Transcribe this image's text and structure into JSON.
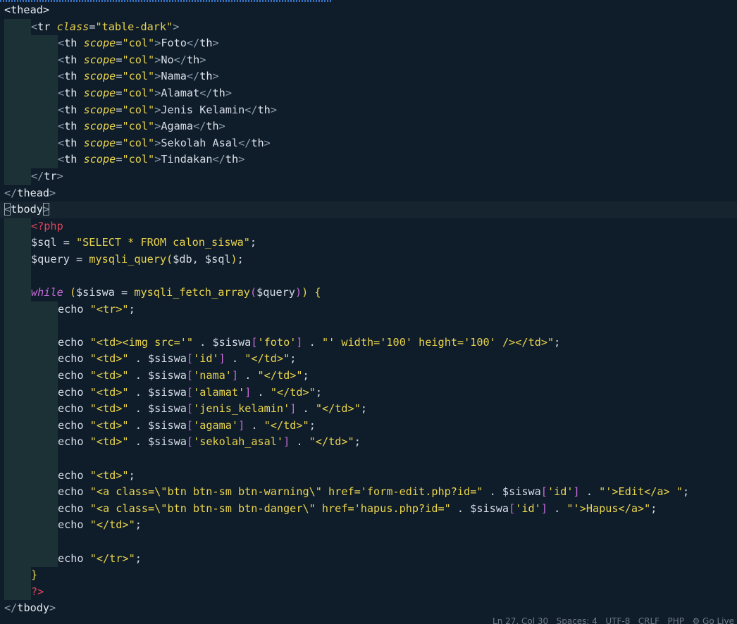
{
  "editor": {
    "language": "PHP",
    "lines": [
      {
        "indent": 0,
        "current": false,
        "tokens": [
          [
            "tag",
            "<thead>"
          ]
        ]
      },
      {
        "indent": 1,
        "current": false,
        "tokens": [
          [
            "punc",
            "<"
          ],
          [
            "tag",
            "tr "
          ],
          [
            "attr",
            "class"
          ],
          [
            "op",
            "="
          ],
          [
            "str",
            "\"table-dark\""
          ],
          [
            "punc",
            ">"
          ]
        ]
      },
      {
        "indent": 2,
        "current": false,
        "tokens": [
          [
            "punc",
            "<"
          ],
          [
            "tag",
            "th "
          ],
          [
            "attr",
            "scope"
          ],
          [
            "op",
            "="
          ],
          [
            "str",
            "\"col\""
          ],
          [
            "punc",
            ">"
          ],
          [
            "plain",
            "Foto"
          ],
          [
            "punc",
            "</"
          ],
          [
            "tag",
            "th"
          ],
          [
            "punc",
            ">"
          ]
        ]
      },
      {
        "indent": 2,
        "current": false,
        "tokens": [
          [
            "punc",
            "<"
          ],
          [
            "tag",
            "th "
          ],
          [
            "attr",
            "scope"
          ],
          [
            "op",
            "="
          ],
          [
            "str",
            "\"col\""
          ],
          [
            "punc",
            ">"
          ],
          [
            "plain",
            "No"
          ],
          [
            "punc",
            "</"
          ],
          [
            "tag",
            "th"
          ],
          [
            "punc",
            ">"
          ]
        ]
      },
      {
        "indent": 2,
        "current": false,
        "tokens": [
          [
            "punc",
            "<"
          ],
          [
            "tag",
            "th "
          ],
          [
            "attr",
            "scope"
          ],
          [
            "op",
            "="
          ],
          [
            "str",
            "\"col\""
          ],
          [
            "punc",
            ">"
          ],
          [
            "plain",
            "Nama"
          ],
          [
            "punc",
            "</"
          ],
          [
            "tag",
            "th"
          ],
          [
            "punc",
            ">"
          ]
        ]
      },
      {
        "indent": 2,
        "current": false,
        "tokens": [
          [
            "punc",
            "<"
          ],
          [
            "tag",
            "th "
          ],
          [
            "attr",
            "scope"
          ],
          [
            "op",
            "="
          ],
          [
            "str",
            "\"col\""
          ],
          [
            "punc",
            ">"
          ],
          [
            "plain",
            "Alamat"
          ],
          [
            "punc",
            "</"
          ],
          [
            "tag",
            "th"
          ],
          [
            "punc",
            ">"
          ]
        ]
      },
      {
        "indent": 2,
        "current": false,
        "tokens": [
          [
            "punc",
            "<"
          ],
          [
            "tag",
            "th "
          ],
          [
            "attr",
            "scope"
          ],
          [
            "op",
            "="
          ],
          [
            "str",
            "\"col\""
          ],
          [
            "punc",
            ">"
          ],
          [
            "plain",
            "Jenis Kelamin"
          ],
          [
            "punc",
            "</"
          ],
          [
            "tag",
            "th"
          ],
          [
            "punc",
            ">"
          ]
        ]
      },
      {
        "indent": 2,
        "current": false,
        "tokens": [
          [
            "punc",
            "<"
          ],
          [
            "tag",
            "th "
          ],
          [
            "attr",
            "scope"
          ],
          [
            "op",
            "="
          ],
          [
            "str",
            "\"col\""
          ],
          [
            "punc",
            ">"
          ],
          [
            "plain",
            "Agama"
          ],
          [
            "punc",
            "</"
          ],
          [
            "tag",
            "th"
          ],
          [
            "punc",
            ">"
          ]
        ]
      },
      {
        "indent": 2,
        "current": false,
        "tokens": [
          [
            "punc",
            "<"
          ],
          [
            "tag",
            "th "
          ],
          [
            "attr",
            "scope"
          ],
          [
            "op",
            "="
          ],
          [
            "str",
            "\"col\""
          ],
          [
            "punc",
            ">"
          ],
          [
            "plain",
            "Sekolah Asal"
          ],
          [
            "punc",
            "</"
          ],
          [
            "tag",
            "th"
          ],
          [
            "punc",
            ">"
          ]
        ]
      },
      {
        "indent": 2,
        "current": false,
        "tokens": [
          [
            "punc",
            "<"
          ],
          [
            "tag",
            "th "
          ],
          [
            "attr",
            "scope"
          ],
          [
            "op",
            "="
          ],
          [
            "str",
            "\"col\""
          ],
          [
            "punc",
            ">"
          ],
          [
            "plain",
            "Tindakan"
          ],
          [
            "punc",
            "</"
          ],
          [
            "tag",
            "th"
          ],
          [
            "punc",
            ">"
          ]
        ]
      },
      {
        "indent": 1,
        "current": false,
        "tokens": [
          [
            "punc",
            "</"
          ],
          [
            "tag",
            "tr"
          ],
          [
            "punc",
            ">"
          ]
        ]
      },
      {
        "indent": 0,
        "current": false,
        "tokens": [
          [
            "punc",
            "</"
          ],
          [
            "tag",
            "thead"
          ],
          [
            "punc",
            ">"
          ]
        ]
      },
      {
        "indent": 0,
        "current": true,
        "tokens": [
          [
            "box",
            "<"
          ],
          [
            "tag",
            "tbody"
          ],
          [
            "box",
            ">"
          ]
        ]
      },
      {
        "indent": 1,
        "current": false,
        "tokens": [
          [
            "php",
            "<?php"
          ]
        ]
      },
      {
        "indent": 1,
        "current": false,
        "tokens": [
          [
            "var",
            "$sql "
          ],
          [
            "op",
            "= "
          ],
          [
            "str",
            "\"SELECT * FROM calon_siswa\""
          ],
          [
            "op",
            ";"
          ]
        ]
      },
      {
        "indent": 1,
        "current": false,
        "tokens": [
          [
            "var",
            "$query "
          ],
          [
            "op",
            "= "
          ],
          [
            "func",
            "mysqli_query"
          ],
          [
            "brace",
            "("
          ],
          [
            "var",
            "$db, $sql"
          ],
          [
            "brace",
            ")"
          ],
          [
            "op",
            ";"
          ]
        ]
      },
      {
        "indent": 1,
        "current": false,
        "tokens": []
      },
      {
        "indent": 1,
        "current": false,
        "tokens": [
          [
            "kw",
            "while "
          ],
          [
            "brace",
            "("
          ],
          [
            "var",
            "$siswa "
          ],
          [
            "op",
            "= "
          ],
          [
            "func",
            "mysqli_fetch_array"
          ],
          [
            "paren2",
            "("
          ],
          [
            "var",
            "$query"
          ],
          [
            "paren2",
            ")"
          ],
          [
            "brace",
            ") {"
          ]
        ]
      },
      {
        "indent": 2,
        "current": false,
        "tokens": [
          [
            "plain",
            "echo "
          ],
          [
            "str",
            "\"<tr>\""
          ],
          [
            "op",
            ";"
          ]
        ]
      },
      {
        "indent": 2,
        "current": false,
        "tokens": []
      },
      {
        "indent": 2,
        "current": false,
        "tokens": [
          [
            "plain",
            "echo "
          ],
          [
            "str",
            "\"<td><img src='\""
          ],
          [
            "op",
            " . "
          ],
          [
            "var",
            "$siswa"
          ],
          [
            "paren2",
            "["
          ],
          [
            "str",
            "'foto'"
          ],
          [
            "paren2",
            "]"
          ],
          [
            "op",
            " . "
          ],
          [
            "str",
            "\"' width='100' height='100' /></td>\""
          ],
          [
            "op",
            ";"
          ]
        ]
      },
      {
        "indent": 2,
        "current": false,
        "tokens": [
          [
            "plain",
            "echo "
          ],
          [
            "str",
            "\"<td>\""
          ],
          [
            "op",
            " . "
          ],
          [
            "var",
            "$siswa"
          ],
          [
            "paren2",
            "["
          ],
          [
            "str",
            "'id'"
          ],
          [
            "paren2",
            "]"
          ],
          [
            "op",
            " . "
          ],
          [
            "str",
            "\"</td>\""
          ],
          [
            "op",
            ";"
          ]
        ]
      },
      {
        "indent": 2,
        "current": false,
        "tokens": [
          [
            "plain",
            "echo "
          ],
          [
            "str",
            "\"<td>\""
          ],
          [
            "op",
            " . "
          ],
          [
            "var",
            "$siswa"
          ],
          [
            "paren2",
            "["
          ],
          [
            "str",
            "'nama'"
          ],
          [
            "paren2",
            "]"
          ],
          [
            "op",
            " . "
          ],
          [
            "str",
            "\"</td>\""
          ],
          [
            "op",
            ";"
          ]
        ]
      },
      {
        "indent": 2,
        "current": false,
        "tokens": [
          [
            "plain",
            "echo "
          ],
          [
            "str",
            "\"<td>\""
          ],
          [
            "op",
            " . "
          ],
          [
            "var",
            "$siswa"
          ],
          [
            "paren2",
            "["
          ],
          [
            "str",
            "'alamat'"
          ],
          [
            "paren2",
            "]"
          ],
          [
            "op",
            " . "
          ],
          [
            "str",
            "\"</td>\""
          ],
          [
            "op",
            ";"
          ]
        ]
      },
      {
        "indent": 2,
        "current": false,
        "tokens": [
          [
            "plain",
            "echo "
          ],
          [
            "str",
            "\"<td>\""
          ],
          [
            "op",
            " . "
          ],
          [
            "var",
            "$siswa"
          ],
          [
            "paren2",
            "["
          ],
          [
            "str",
            "'jenis_kelamin'"
          ],
          [
            "paren2",
            "]"
          ],
          [
            "op",
            " . "
          ],
          [
            "str",
            "\"</td>\""
          ],
          [
            "op",
            ";"
          ]
        ]
      },
      {
        "indent": 2,
        "current": false,
        "tokens": [
          [
            "plain",
            "echo "
          ],
          [
            "str",
            "\"<td>\""
          ],
          [
            "op",
            " . "
          ],
          [
            "var",
            "$siswa"
          ],
          [
            "paren2",
            "["
          ],
          [
            "str",
            "'agama'"
          ],
          [
            "paren2",
            "]"
          ],
          [
            "op",
            " . "
          ],
          [
            "str",
            "\"</td>\""
          ],
          [
            "op",
            ";"
          ]
        ]
      },
      {
        "indent": 2,
        "current": false,
        "tokens": [
          [
            "plain",
            "echo "
          ],
          [
            "str",
            "\"<td>\""
          ],
          [
            "op",
            " . "
          ],
          [
            "var",
            "$siswa"
          ],
          [
            "paren2",
            "["
          ],
          [
            "str",
            "'sekolah_asal'"
          ],
          [
            "paren2",
            "]"
          ],
          [
            "op",
            " . "
          ],
          [
            "str",
            "\"</td>\""
          ],
          [
            "op",
            ";"
          ]
        ]
      },
      {
        "indent": 2,
        "current": false,
        "tokens": []
      },
      {
        "indent": 2,
        "current": false,
        "tokens": [
          [
            "plain",
            "echo "
          ],
          [
            "str",
            "\"<td>\""
          ],
          [
            "op",
            ";"
          ]
        ]
      },
      {
        "indent": 2,
        "current": false,
        "tokens": [
          [
            "plain",
            "echo "
          ],
          [
            "str",
            "\"<a class=\\\"btn btn-sm btn-warning\\\" href='form-edit.php?id=\""
          ],
          [
            "op",
            " . "
          ],
          [
            "var",
            "$siswa"
          ],
          [
            "paren2",
            "["
          ],
          [
            "str",
            "'id'"
          ],
          [
            "paren2",
            "]"
          ],
          [
            "op",
            " . "
          ],
          [
            "str",
            "\"'>Edit</a> \""
          ],
          [
            "op",
            ";"
          ]
        ]
      },
      {
        "indent": 2,
        "current": false,
        "tokens": [
          [
            "plain",
            "echo "
          ],
          [
            "str",
            "\"<a class=\\\"btn btn-sm btn-danger\\\" href='hapus.php?id=\""
          ],
          [
            "op",
            " . "
          ],
          [
            "var",
            "$siswa"
          ],
          [
            "paren2",
            "["
          ],
          [
            "str",
            "'id'"
          ],
          [
            "paren2",
            "]"
          ],
          [
            "op",
            " . "
          ],
          [
            "str",
            "\"'>Hapus</a>\""
          ],
          [
            "op",
            ";"
          ]
        ]
      },
      {
        "indent": 2,
        "current": false,
        "tokens": [
          [
            "plain",
            "echo "
          ],
          [
            "str",
            "\"</td>\""
          ],
          [
            "op",
            ";"
          ]
        ]
      },
      {
        "indent": 2,
        "current": false,
        "tokens": []
      },
      {
        "indent": 2,
        "current": false,
        "tokens": [
          [
            "plain",
            "echo "
          ],
          [
            "str",
            "\"</tr>\""
          ],
          [
            "op",
            ";"
          ]
        ]
      },
      {
        "indent": 1,
        "current": false,
        "tokens": [
          [
            "brace",
            "}"
          ]
        ]
      },
      {
        "indent": 1,
        "current": false,
        "tokens": [
          [
            "php",
            "?>"
          ]
        ]
      },
      {
        "indent": 0,
        "current": false,
        "tokens": [
          [
            "punc",
            "</"
          ],
          [
            "tag",
            "tbody"
          ],
          [
            "punc",
            ">"
          ]
        ]
      }
    ]
  },
  "status_bar": {
    "text": "Ln 27, Col 30   Spaces: 4   UTF-8   CRLF   PHP   ⚙ Go Live"
  },
  "colors": {
    "background": "#0f1c2a",
    "current_line": "#15242f",
    "indent_guide": "#284440",
    "tag": "#e4eaf0",
    "attribute": "#e8d44d",
    "string": "#e8d44d",
    "php_tag": "#e0455a",
    "keyword": "#c66dd6"
  }
}
